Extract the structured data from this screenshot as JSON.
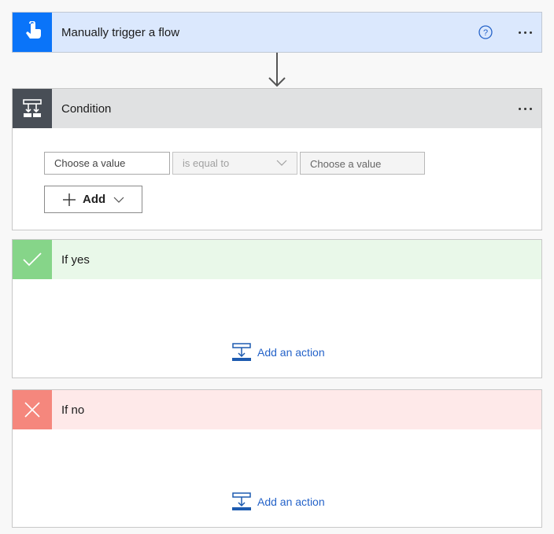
{
  "trigger": {
    "title": "Manually trigger a flow",
    "icon": "touch-hand-icon",
    "accent_color": "#0a74f9",
    "header_color": "#dbe8fd"
  },
  "condition": {
    "title": "Condition",
    "icon": "condition-branch-icon",
    "left_value_placeholder": "Choose a value",
    "operator": "is equal to",
    "right_value_placeholder": "Choose a value",
    "add_button_label": "Add"
  },
  "branches": [
    {
      "id": "yes",
      "title": "If yes",
      "icon": "checkmark-icon",
      "accent_color": "#86d589",
      "add_action_label": "Add an action"
    },
    {
      "id": "no",
      "title": "If no",
      "icon": "close-x-icon",
      "accent_color": "#f5877d",
      "add_action_label": "Add an action"
    }
  ]
}
